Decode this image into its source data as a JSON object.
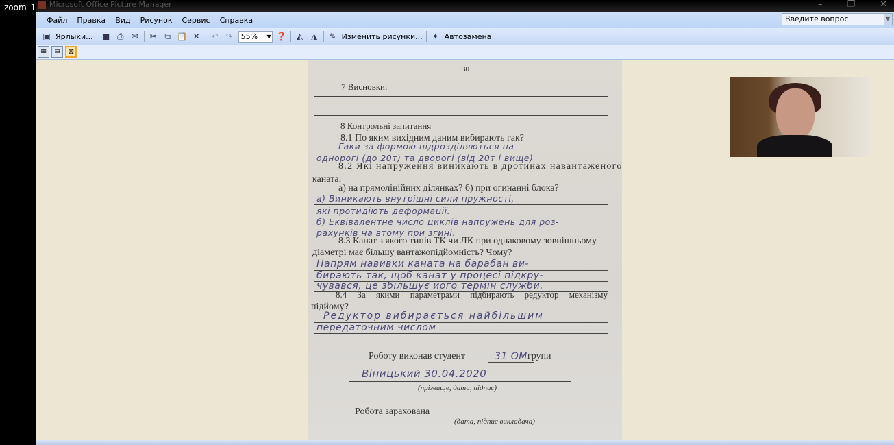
{
  "zoom_label": "zoom_1",
  "window": {
    "title": "Microsoft Office Picture Manager"
  },
  "menu": [
    "Файл",
    "Правка",
    "Вид",
    "Рисунок",
    "Сервис",
    "Справка"
  ],
  "help_search": {
    "placeholder": "Введите вопрос"
  },
  "toolbar": {
    "shortcuts": "Ярлыки...",
    "zoom": "55%",
    "edit_pictures": "Изменить рисунки...",
    "autocorrect": "Автозамена"
  },
  "document": {
    "page_number": "30",
    "s7": "7 Висновки:",
    "s8": "8 Контрольні запитання",
    "q81": "8.1 По яким вихідним даним вибирають гак?",
    "a81": [
      "Гаки за формою підрозділяються на",
      "однорогі (до 20т) та дворогі (від 20т і вище)"
    ],
    "q82a": "8.2 Які напруження виникають в дротинах навантаженого",
    "q82b": "каната:",
    "q82c": "а) на прямолінійних ділянках?   б) при огинанні блока?",
    "a82": [
      "а) Виникають внутрішні сили пружності,",
      "які протидіють деформації.",
      "б) Еквівалентне число циклів напружень для роз-",
      "рахунків на втому при згині."
    ],
    "q83a": "8.3 Канат з якого типів ТК чи ЛК при однаковому зовнішньому",
    "q83b": "діаметрі має більшу вантажопідйомність? Чому?",
    "a83": [
      "Напрям навивки каната на барабан ви-",
      "бирають так, щоб канат у процесі підкру-",
      "чувався, це збільшує його термін служби."
    ],
    "q84a": "8.4 За якими параметрами підбирають редуктор механізму",
    "q84b": "підйому?",
    "a84": [
      "Редуктор вибирається найбільшим",
      "передаточним числом"
    ],
    "done_by": "Роботу виконав студент",
    "group": "31 ОМ",
    "group_suffix": "групи",
    "signature": "Віницький 30.04.2020",
    "sig_caption": "(прізвище, дата, підпис)",
    "accepted": "Робота зарахована",
    "acc_caption": "(дата, підпис викладача)"
  }
}
